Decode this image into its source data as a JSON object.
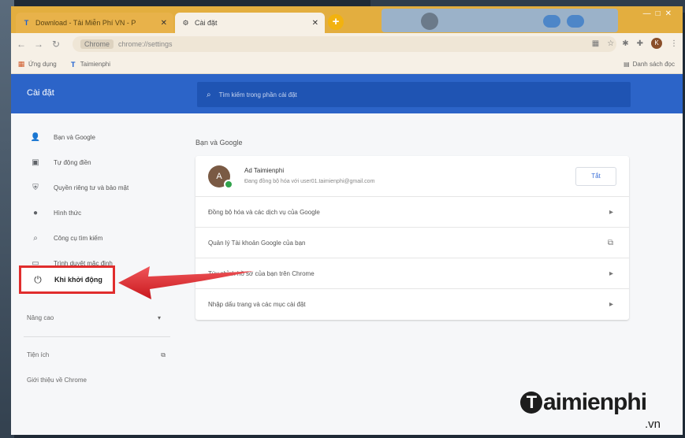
{
  "tabs": [
    {
      "label": "Download - Tải Miễn Phí VN - P",
      "icon": "T",
      "active": false
    },
    {
      "label": "Cài đặt",
      "icon": "gear",
      "active": true
    }
  ],
  "toolbar": {
    "url_chip": "Chrome",
    "url": "chrome://settings",
    "profile_initial": "K"
  },
  "bookmarks": {
    "items": [
      {
        "label": "Ứng dụng",
        "icon": "apps-icon"
      },
      {
        "label": "Taimienphi",
        "icon": "taimienphi-icon"
      }
    ],
    "reading_list": "Danh sách đọc"
  },
  "settings": {
    "title": "Cài đặt",
    "search_placeholder": "Tìm kiếm trong phần cài đặt"
  },
  "nav": {
    "items": [
      {
        "label": "Bạn và Google",
        "icon": "person-icon"
      },
      {
        "label": "Tự động điền",
        "icon": "clipboard-icon"
      },
      {
        "label": "Quyền riêng tư và bảo mật",
        "icon": "shield-icon"
      },
      {
        "label": "Hình thức",
        "icon": "palette-icon"
      },
      {
        "label": "Công cụ tìm kiếm",
        "icon": "search-icon"
      },
      {
        "label": "Trình duyệt mặc định",
        "icon": "browser-icon"
      }
    ],
    "highlighted": {
      "label": "Khi khởi động",
      "icon": "power-icon"
    },
    "advanced": "Nâng cao",
    "extensions": "Tiện ích",
    "about": "Giới thiệu về Chrome"
  },
  "main": {
    "section_title": "Bạn và Google",
    "profile": {
      "initial": "A",
      "name": "Ad Taimienphi",
      "status": "Đang đồng bộ hóa với user01.taimienphi@gmail.com",
      "button": "Tắt"
    },
    "rows": [
      {
        "label": "Đồng bộ hóa và các dịch vụ của Google",
        "action": "chevron"
      },
      {
        "label": "Quản lý Tài khoản Google của bạn",
        "action": "external"
      },
      {
        "label": "Tùy chỉnh hồ sơ của bạn trên Chrome",
        "action": "chevron"
      },
      {
        "label": "Nhập dấu trang và các mục cài đặt",
        "action": "chevron"
      }
    ]
  },
  "watermark": {
    "brand": "aimienphi",
    "brand_initial": "T",
    "suffix": ".vn"
  },
  "colors": {
    "header_blue": "#2c64c8",
    "tab_strip": "#e3ae3f",
    "highlight_red": "#e02d2d",
    "arrow_red": "#e3262b"
  }
}
